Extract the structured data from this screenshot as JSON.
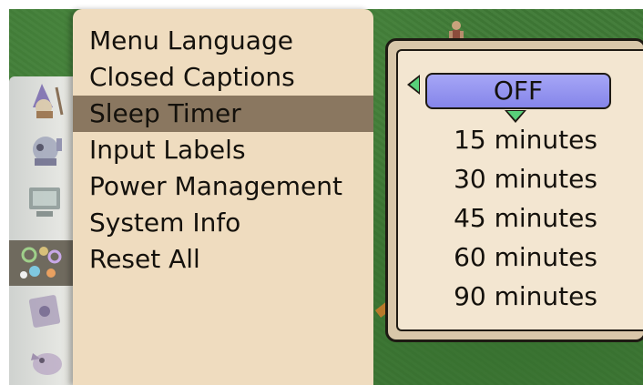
{
  "menu": {
    "items": [
      {
        "label": "Menu Language"
      },
      {
        "label": "Closed Captions"
      },
      {
        "label": "Sleep Timer",
        "active": true
      },
      {
        "label": "Input Labels"
      },
      {
        "label": "Power Management"
      },
      {
        "label": "System Info"
      },
      {
        "label": "Reset All"
      }
    ]
  },
  "submenu": {
    "title": "Sleep Timer",
    "selected_index": 0,
    "options": [
      {
        "label": "OFF"
      },
      {
        "label": "15 minutes"
      },
      {
        "label": "30 minutes"
      },
      {
        "label": "45 minutes"
      },
      {
        "label": "60 minutes"
      },
      {
        "label": "90 minutes"
      }
    ]
  },
  "icon_strip": {
    "icons": [
      {
        "icon": "wizard-character-icon"
      },
      {
        "icon": "robot-character-icon"
      },
      {
        "icon": "computer-monitor-icon"
      },
      {
        "icon": "gears-settings-icon",
        "selected": true
      },
      {
        "icon": "puzzle-card-icon"
      },
      {
        "icon": "creature-character-icon"
      }
    ]
  },
  "colors": {
    "menu_background": "#efdcbf",
    "menu_highlight": "#8a7760",
    "selected_option": "#8f8fee",
    "arrow_accent": "#58d07a",
    "frame_border": "#1e1a13"
  }
}
